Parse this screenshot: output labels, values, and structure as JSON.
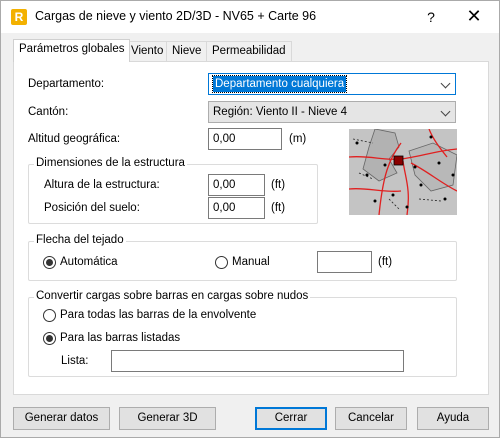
{
  "window": {
    "title": "Cargas de nieve y viento 2D/3D - NV65 + Carte 96",
    "app_icon_letter": "R",
    "help_glyph": "?",
    "close_glyph": "✕"
  },
  "tabs": [
    {
      "label": "Parámetros globales",
      "active": true
    },
    {
      "label": "Viento",
      "active": false
    },
    {
      "label": "Nieve",
      "active": false
    },
    {
      "label": "Permeabilidad",
      "active": false
    }
  ],
  "departamento": {
    "label": "Departamento:",
    "value": "Departamento cualquiera"
  },
  "canton": {
    "label": "Cantón:",
    "value": "Región: Viento II - Nieve 4"
  },
  "altitud": {
    "label": "Altitud geográfica:",
    "value": "0,00",
    "unit": "(m)"
  },
  "dimensiones": {
    "title": "Dimensiones de la estructura",
    "altura": {
      "label": "Altura de la estructura:",
      "value": "0,00",
      "unit": "(ft)"
    },
    "posicion": {
      "label": "Posición del suelo:",
      "value": "0,00",
      "unit": "(ft)"
    }
  },
  "flecha": {
    "title": "Flecha del tejado",
    "automatica": {
      "label": "Automática",
      "selected": true
    },
    "manual": {
      "label": "Manual",
      "selected": false
    },
    "manual_value": "",
    "unit": "(ft)"
  },
  "convertir": {
    "title": "Convertir cargas sobre barras en cargas sobre nudos",
    "todas": {
      "label": "Para todas las barras de la envolvente",
      "selected": false
    },
    "listadas": {
      "label": "Para las barras listadas",
      "selected": true
    },
    "lista_label": "Lista:",
    "lista_value": ""
  },
  "buttons": {
    "generar_datos": "Generar datos",
    "generar_3d": "Generar 3D",
    "cerrar": "Cerrar",
    "cancelar": "Cancelar",
    "ayuda": "Ayuda"
  },
  "colors": {
    "accent": "#0078d7",
    "map_lines": "#e02020",
    "map_region": "#8a0000"
  }
}
